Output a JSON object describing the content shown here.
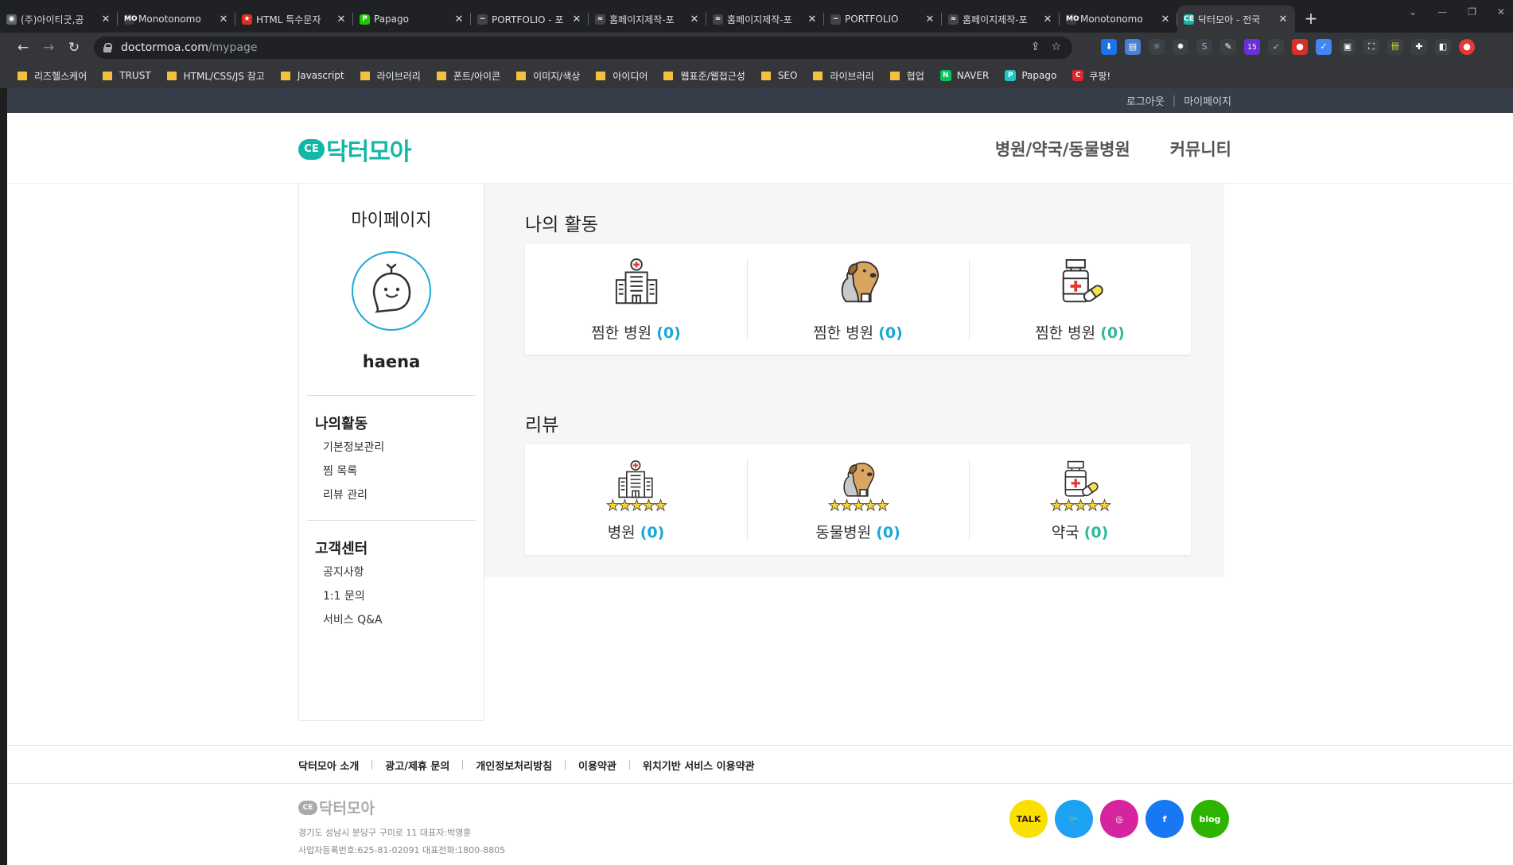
{
  "browser": {
    "tabs": [
      {
        "label": "(주)아이티굿,공",
        "icon": "globe-icon",
        "color": "#5f6368",
        "glyph": "◉"
      },
      {
        "label": "Monotonomo",
        "icon": "mo-logo-icon",
        "color": "#3c3c3c",
        "glyph": "MO"
      },
      {
        "label": "HTML 특수문자",
        "icon": "star-icon",
        "color": "#d93025",
        "glyph": "★"
      },
      {
        "label": "Papago",
        "icon": "papago-icon",
        "color": "#1ec800",
        "glyph": "P"
      },
      {
        "label": "PORTFOLIO - 포",
        "icon": "portfolio-icon",
        "color": "#444",
        "glyph": "~"
      },
      {
        "label": "홈페이지제작-포",
        "icon": "site-icon",
        "color": "#444",
        "glyph": "≈"
      },
      {
        "label": "홈페이지제작-포",
        "icon": "site-icon",
        "color": "#444",
        "glyph": "≈"
      },
      {
        "label": "PORTFOLIO",
        "icon": "portfolio-icon",
        "color": "#444",
        "glyph": "~"
      },
      {
        "label": "홈페이지제작-포",
        "icon": "site-icon",
        "color": "#444",
        "glyph": "≈"
      },
      {
        "label": "Monotonomo",
        "icon": "mo-logo-icon",
        "color": "#3c3c3c",
        "glyph": "MO"
      },
      {
        "label": "닥터모아 - 전국",
        "icon": "doctormoa-icon",
        "color": "#12b7a7",
        "glyph": "CE",
        "active": true
      }
    ],
    "new_tab": "+",
    "url_host": "doctormoa.com",
    "url_path": "/mypage",
    "extension_badge": "15",
    "bookmarks": [
      {
        "label": "리즈헬스케어",
        "type": "folder"
      },
      {
        "label": "TRUST",
        "type": "folder"
      },
      {
        "label": "HTML/CSS/JS 참고",
        "type": "folder"
      },
      {
        "label": "Javascript",
        "type": "folder"
      },
      {
        "label": "라이브러리",
        "type": "folder"
      },
      {
        "label": "폰트/아이콘",
        "type": "folder"
      },
      {
        "label": "이미지/색상",
        "type": "folder"
      },
      {
        "label": "아이디어",
        "type": "folder"
      },
      {
        "label": "웹표준/웹접근성",
        "type": "folder"
      },
      {
        "label": "SEO",
        "type": "folder"
      },
      {
        "label": "라이브러리",
        "type": "folder"
      },
      {
        "label": "협업",
        "type": "folder"
      },
      {
        "label": "NAVER",
        "type": "site",
        "color": "#03c75a",
        "glyph": "N"
      },
      {
        "label": "Papago",
        "type": "site",
        "color": "#1ec8c8",
        "glyph": "P"
      },
      {
        "label": "쿠팡!",
        "type": "site",
        "color": "#e0262c",
        "glyph": "C"
      }
    ]
  },
  "site": {
    "topbar": {
      "logout": "로그아웃",
      "mypage": "마이페이지"
    },
    "logo": {
      "mark": "CE",
      "text": "닥터모아"
    },
    "gnb": [
      "병원/약국/동물병원",
      "커뮤니티"
    ],
    "brand_color": "#12b7a7"
  },
  "sidebar": {
    "title": "마이페이지",
    "username": "haena",
    "group1": {
      "title": "나의활동",
      "items": [
        "기본정보관리",
        "찜 목록",
        "리뷰 관리"
      ]
    },
    "group2": {
      "title": "고객센터",
      "items": [
        "공지사항",
        "1:1 문의",
        "서비스 Q&A"
      ]
    }
  },
  "activity": {
    "title": "나의 활동",
    "cells": [
      {
        "label": "찜한 병원",
        "count": "(0)",
        "icon": "hospital-building-icon",
        "color": "#1aa8d8"
      },
      {
        "label": "찜한 병원",
        "count": "(0)",
        "icon": "pet-dog-cat-icon",
        "color": "#1aa8d8"
      },
      {
        "label": "찜한 병원",
        "count": "(0)",
        "icon": "pharmacy-medicine-icon",
        "color": "#2fb89e"
      }
    ]
  },
  "review": {
    "title": "리뷰",
    "stars": "★★★★★",
    "cells": [
      {
        "label": "병원",
        "count": "(0)",
        "icon": "hospital-building-icon",
        "color": "#1aa8d8"
      },
      {
        "label": "동물병원",
        "count": "(0)",
        "icon": "pet-dog-cat-icon",
        "color": "#1aa8d8"
      },
      {
        "label": "약국",
        "count": "(0)",
        "icon": "pharmacy-medicine-icon",
        "color": "#2fb89e"
      }
    ]
  },
  "footer": {
    "links": [
      "닥터모아 소개",
      "광고/제휴 문의",
      "개인정보처리방침",
      "이용약관",
      "위치기반 서비스 이용약관"
    ],
    "logo_text": "닥터모아",
    "address": "경기도 성남시 분당구 구미로 11 대표자:박영훈",
    "biz": "사업자등록번호:625-81-02091 대표전화:1800-8805",
    "social": [
      {
        "name": "kakaotalk-icon",
        "label": "TALK",
        "bg": "#f9e000",
        "fg": "#3a1d1d"
      },
      {
        "name": "twitter-icon",
        "label": "🐦",
        "bg": "#1da1f2",
        "fg": "#fff"
      },
      {
        "name": "instagram-icon",
        "label": "◎",
        "bg": "#d6249f",
        "fg": "#fff"
      },
      {
        "name": "facebook-icon",
        "label": "f",
        "bg": "#1877f2",
        "fg": "#fff"
      },
      {
        "name": "blog-icon",
        "label": "blog",
        "bg": "#2db400",
        "fg": "#fff"
      }
    ]
  }
}
